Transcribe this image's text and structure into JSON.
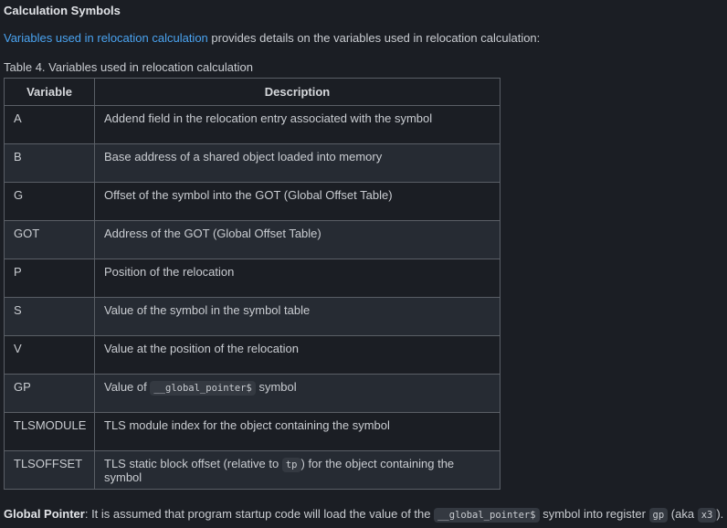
{
  "section": {
    "title": "Calculation Symbols"
  },
  "intro": {
    "link_text": "Variables used in relocation calculation",
    "rest_text": " provides details on the variables used in relocation calculation:"
  },
  "table": {
    "caption": "Table 4. Variables used in relocation calculation",
    "headers": [
      "Variable",
      "Description"
    ],
    "rows": [
      {
        "variable": "A",
        "desc": "Addend field in the relocation entry associated with the symbol"
      },
      {
        "variable": "B",
        "desc": "Base address of a shared object loaded into memory"
      },
      {
        "variable": "G",
        "desc": "Offset of the symbol into the GOT (Global Offset Table)"
      },
      {
        "variable": "GOT",
        "desc": "Address of the GOT (Global Offset Table)"
      },
      {
        "variable": "P",
        "desc": "Position of the relocation"
      },
      {
        "variable": "S",
        "desc": "Value of the symbol in the symbol table"
      },
      {
        "variable": "V",
        "desc": "Value at the position of the relocation"
      },
      {
        "variable": "GP",
        "desc_pre": "Value of ",
        "desc_code": "__global_pointer$",
        "desc_post": " symbol"
      },
      {
        "variable": "TLSMODULE",
        "desc": "TLS module index for the object containing the symbol"
      },
      {
        "variable": "TLSOFFSET",
        "desc_pre": "TLS static block offset (relative to ",
        "desc_code": "tp",
        "desc_post": ") for the object containing the symbol"
      }
    ]
  },
  "footer": {
    "bold": "Global Pointer",
    "text1": ": It is assumed that program startup code will load the value of the ",
    "code1": "__global_pointer$",
    "text2": " symbol into register ",
    "code2": "gp",
    "text3": " (aka ",
    "code3": "x3",
    "text4": ")."
  }
}
